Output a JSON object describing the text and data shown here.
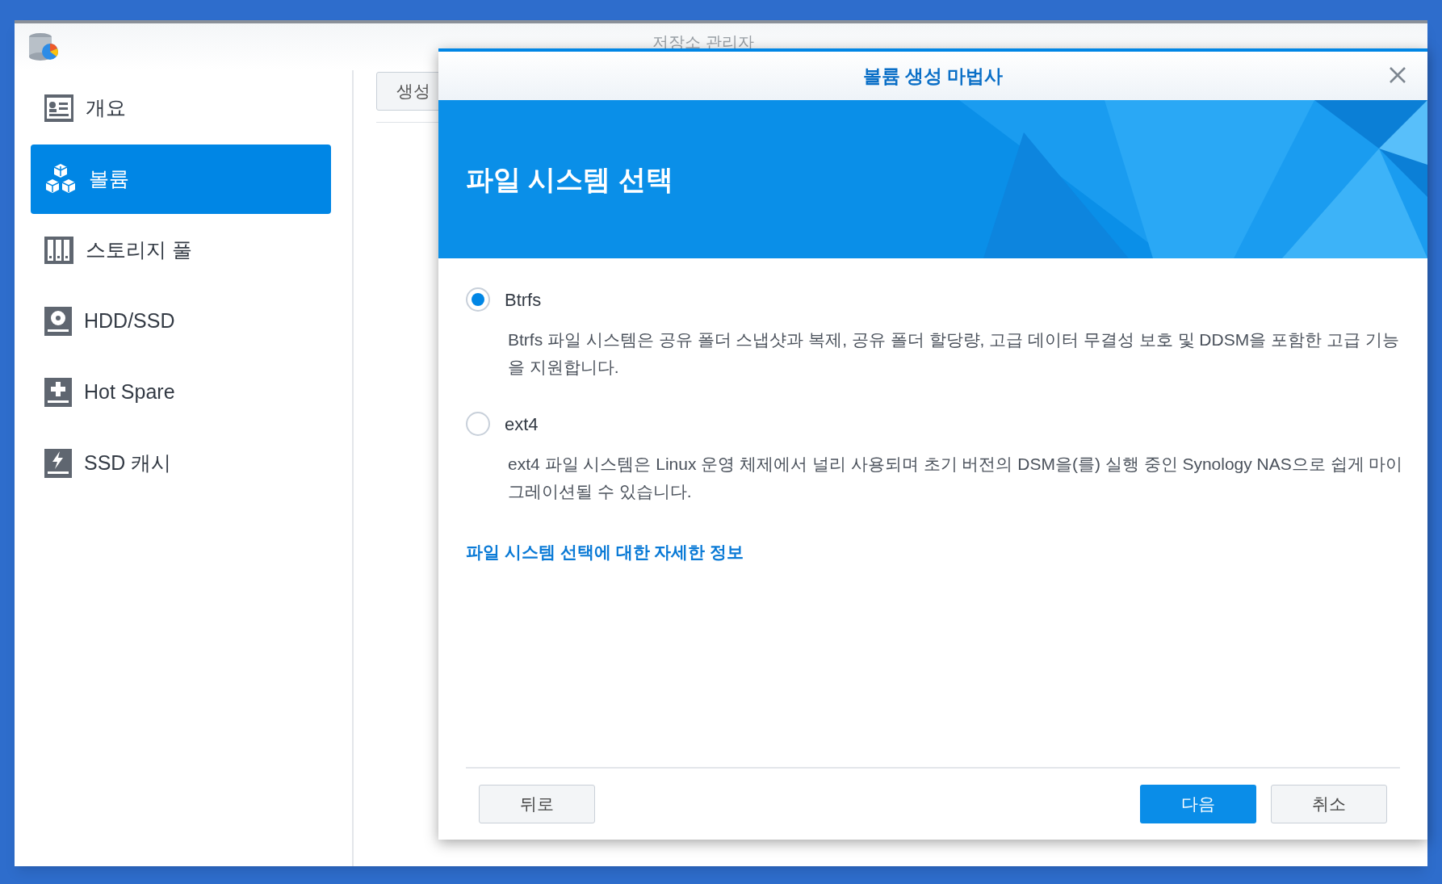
{
  "app": {
    "title": "저장소 관리자"
  },
  "sidebar": {
    "items": [
      {
        "label": "개요",
        "kind": "overview",
        "selected": false
      },
      {
        "label": "볼륨",
        "kind": "volume",
        "selected": true
      },
      {
        "label": "스토리지 풀",
        "kind": "pool",
        "selected": false
      },
      {
        "label": "HDD/SSD",
        "kind": "disk",
        "selected": false
      },
      {
        "label": "Hot Spare",
        "kind": "spare",
        "selected": false
      },
      {
        "label": "SSD 캐시",
        "kind": "cache",
        "selected": false
      }
    ]
  },
  "toolbar": {
    "buttons": [
      "생성"
    ]
  },
  "dialog": {
    "title": "볼륨 생성 마법사",
    "heading": "파일 시스템 선택",
    "options": [
      {
        "label": "Btrfs",
        "description": "Btrfs 파일 시스템은 공유 폴더 스냅샷과 복제, 공유 폴더 할당량, 고급 데이터 무결성 보호 및 DDSM을 포함한 고급 기능을 지원합니다.",
        "selected": true
      },
      {
        "label": "ext4",
        "description": "ext4 파일 시스템은 Linux 운영 체제에서 널리 사용되며 초기 버전의 DSM을(를) 실행 중인 Synology NAS으로 쉽게 마이그레이션될 수 있습니다.",
        "selected": false
      }
    ],
    "link": "파일 시스템 선택에 대한 자세한 정보",
    "buttons": {
      "back": "뒤로",
      "next": "다음",
      "cancel": "취소"
    }
  }
}
